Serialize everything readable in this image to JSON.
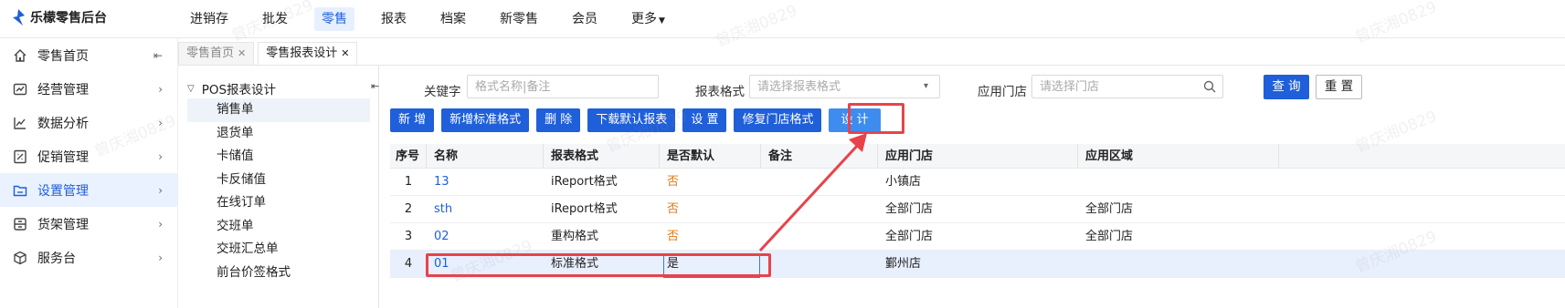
{
  "app": {
    "title": "乐檬零售后台"
  },
  "topnav": [
    {
      "label": "进销存",
      "active": false
    },
    {
      "label": "批发",
      "active": false
    },
    {
      "label": "零售",
      "active": true
    },
    {
      "label": "报表",
      "active": false
    },
    {
      "label": "档案",
      "active": false
    },
    {
      "label": "新零售",
      "active": false
    },
    {
      "label": "会员",
      "active": false
    },
    {
      "label": "更多",
      "active": false
    }
  ],
  "sidebar": {
    "collapse_icon": "collapse-left-icon",
    "items": [
      {
        "label": "零售首页",
        "icon": "home-icon"
      },
      {
        "label": "经营管理",
        "icon": "chart-icon"
      },
      {
        "label": "数据分析",
        "icon": "trend-icon"
      },
      {
        "label": "促销管理",
        "icon": "promo-icon"
      },
      {
        "label": "设置管理",
        "icon": "folder-icon",
        "active": true
      },
      {
        "label": "货架管理",
        "icon": "shelf-icon"
      },
      {
        "label": "服务台",
        "icon": "cube-icon"
      }
    ]
  },
  "tabs": [
    {
      "label": "零售首页",
      "active": false
    },
    {
      "label": "零售报表设计",
      "active": true
    }
  ],
  "tree": {
    "root": "POS报表设计",
    "nodes": [
      "销售单",
      "退货单",
      "卡储值",
      "卡反储值",
      "在线订单",
      "交班单",
      "交班汇总单",
      "前台价签格式"
    ],
    "selected_index": 0
  },
  "search": {
    "keyword_label": "关键字",
    "keyword_placeholder": "格式名称|备注",
    "format_label": "报表格式",
    "format_placeholder": "请选择报表格式",
    "store_label": "应用门店",
    "store_placeholder": "请选择门店",
    "query_label": "查 询",
    "reset_label": "重 置"
  },
  "toolbar": {
    "add": "新 增",
    "add_std": "新增标准格式",
    "delete": "删 除",
    "download": "下载默认报表",
    "set": "设 置",
    "repair": "修复门店格式",
    "design": "设 计"
  },
  "table": {
    "headers": [
      "序号",
      "名称",
      "报表格式",
      "是否默认",
      "备注",
      "应用门店",
      "应用区域"
    ],
    "rows": [
      {
        "no": "1",
        "name": "13",
        "format": "iReport格式",
        "default": "否",
        "note": "",
        "store": "小镇店",
        "region": ""
      },
      {
        "no": "2",
        "name": "sth",
        "format": "iReport格式",
        "default": "否",
        "note": "",
        "store": "全部门店",
        "region": "全部门店"
      },
      {
        "no": "3",
        "name": "02",
        "format": "重构格式",
        "default": "否",
        "note": "",
        "store": "全部门店",
        "region": "全部门店"
      },
      {
        "no": "4",
        "name": "01",
        "format": "标准格式",
        "default": "是",
        "note": "",
        "store": "鄞州店",
        "region": ""
      }
    ],
    "selected_row": 3
  },
  "watermark": "曾庆湘0829",
  "colors": {
    "primary": "#1f5fd9",
    "annotation": "#e8434a",
    "default_no": "#e07a16"
  }
}
